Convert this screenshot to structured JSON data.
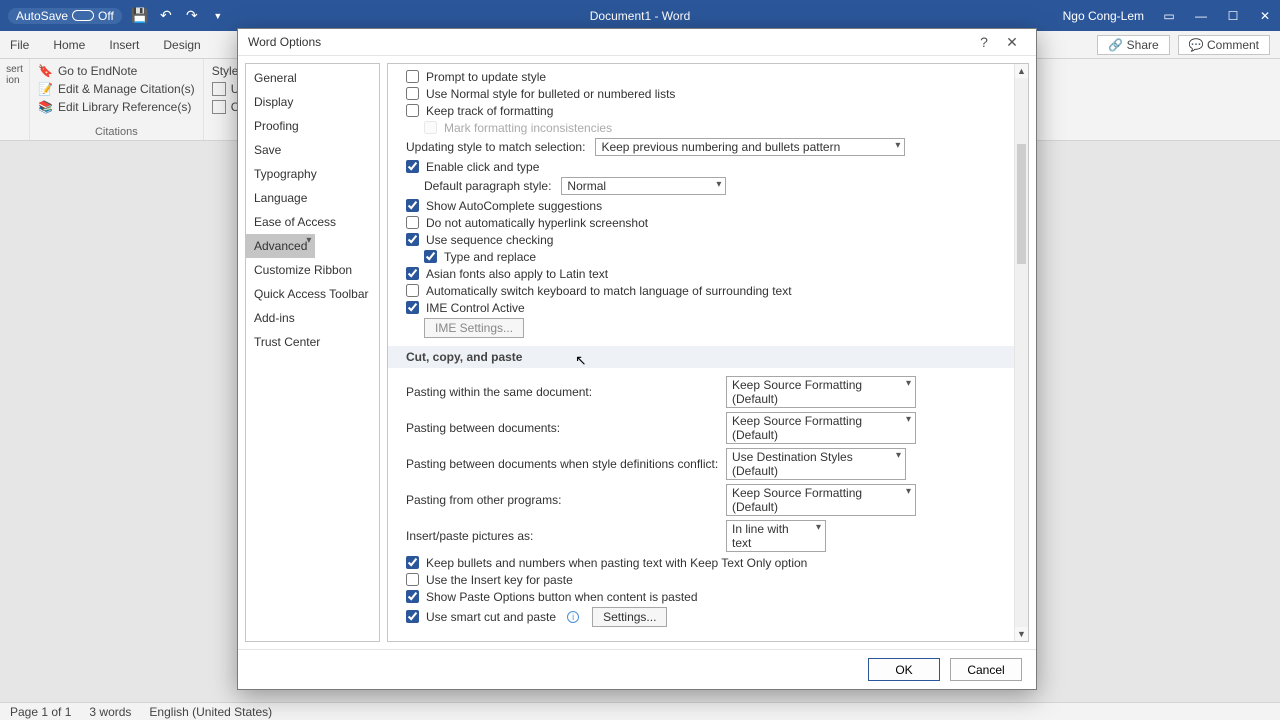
{
  "titlebar": {
    "autosave": "AutoSave",
    "off": "Off",
    "doc": "Document1 - Word",
    "user": "Ngo Cong-Lem"
  },
  "tabs": {
    "file": "File",
    "home": "Home",
    "insert": "Insert",
    "design": "Design",
    "share": "Share",
    "comment": "Comment"
  },
  "ribbon": {
    "endnote": "Go to EndNote",
    "editCitations": "Edit & Manage Citation(s)",
    "editLibrary": "Edit Library Reference(s)",
    "citations": "Citations",
    "style": "Style:",
    "up": "Up",
    "co": "Co"
  },
  "dialog": {
    "title": "Word Options",
    "categories": [
      "General",
      "Display",
      "Proofing",
      "Save",
      "Typography",
      "Language",
      "Ease of Access",
      "Advanced",
      "Customize Ribbon",
      "Quick Access Toolbar",
      "Add-ins",
      "Trust Center"
    ],
    "opts": {
      "promptUpdateStyle": "Prompt to update style",
      "useNormal": "Use Normal style for bulleted or numbered lists",
      "keepTrack": "Keep track of formatting",
      "markInconsistencies": "Mark formatting inconsistencies",
      "updatingStyle": "Updating style to match selection:",
      "updatingStyleVal": "Keep previous numbering and bullets pattern",
      "enableClick": "Enable click and type",
      "defaultPara": "Default paragraph style:",
      "defaultParaVal": "Normal",
      "autoComplete": "Show AutoComplete suggestions",
      "noHyperlink": "Do not automatically hyperlink screenshot",
      "seqCheck": "Use sequence checking",
      "typeReplace": "Type and replace",
      "asianFonts": "Asian fonts also apply to Latin text",
      "autoKeyboard": "Automatically switch keyboard to match language of surrounding text",
      "imeActive": "IME Control Active",
      "imeSettings": "IME Settings...",
      "section2": "Cut, copy, and paste",
      "pasteWithin": "Pasting within the same document:",
      "pasteBetween": "Pasting between documents:",
      "pasteConflict": "Pasting between documents when style definitions conflict:",
      "pasteOther": "Pasting from other programs:",
      "insertPics": "Insert/paste pictures as:",
      "keepSource": "Keep Source Formatting (Default)",
      "useDest": "Use Destination Styles (Default)",
      "inline": "In line with text",
      "keepBullets": "Keep bullets and numbers when pasting text with Keep Text Only option",
      "useInsertKey": "Use the Insert key for paste",
      "showPasteOptions": "Show Paste Options button when content is pasted",
      "smartCut": "Use smart cut and paste",
      "settingsBtn": "Settings..."
    },
    "ok": "OK",
    "cancel": "Cancel"
  },
  "status": {
    "page": "Page 1 of 1",
    "words": "3 words",
    "lang": "English (United States)"
  }
}
